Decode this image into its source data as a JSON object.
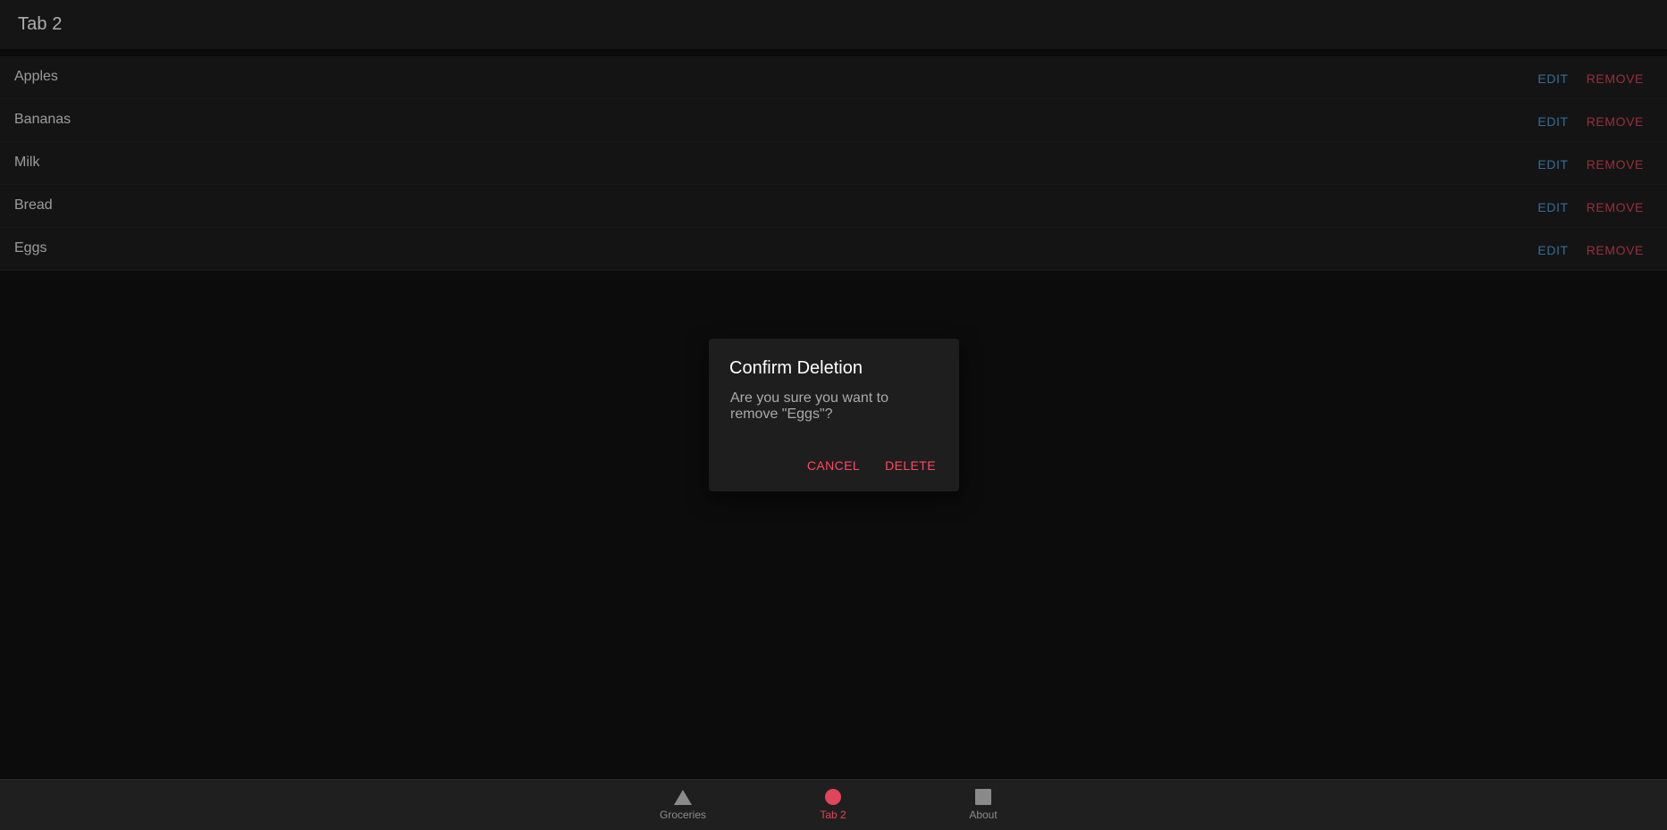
{
  "header": {
    "title": "Tab 2"
  },
  "list": {
    "items": [
      {
        "label": "Apples",
        "edit_label": "EDIT",
        "remove_label": "REMOVE"
      },
      {
        "label": "Bananas",
        "edit_label": "EDIT",
        "remove_label": "REMOVE"
      },
      {
        "label": "Milk",
        "edit_label": "EDIT",
        "remove_label": "REMOVE"
      },
      {
        "label": "Bread",
        "edit_label": "EDIT",
        "remove_label": "REMOVE"
      },
      {
        "label": "Eggs",
        "edit_label": "EDIT",
        "remove_label": "REMOVE"
      }
    ]
  },
  "dialog": {
    "title": "Confirm Deletion",
    "message": "Are you sure you want to remove \"Eggs\"?",
    "cancel_label": "CANCEL",
    "delete_label": "DELETE"
  },
  "tabbar": {
    "tabs": [
      {
        "label": "Groceries",
        "icon": "triangle-icon",
        "active": false
      },
      {
        "label": "Tab 2",
        "icon": "circle-icon",
        "active": true
      },
      {
        "label": "About",
        "icon": "square-icon",
        "active": false
      }
    ]
  },
  "colors": {
    "accent": "#e0455a",
    "edit": "#4aa3df",
    "dialog_button": "#ff4961"
  }
}
